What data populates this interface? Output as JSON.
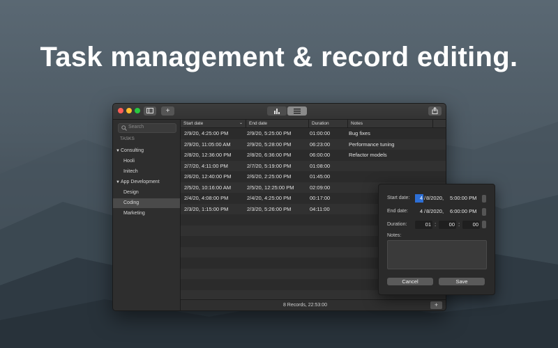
{
  "headline": "Task management & record editing.",
  "sidebar": {
    "search_placeholder": "Search",
    "section_label": "TASKS",
    "groups": [
      {
        "label": "Consulting",
        "items": [
          "Hooli",
          "Initech"
        ]
      },
      {
        "label": "App Development",
        "items": [
          "Design",
          "Coding",
          "Marketing"
        ]
      }
    ],
    "selected": "Coding"
  },
  "table": {
    "columns": [
      "Start date",
      "End date",
      "Duration",
      "Notes"
    ],
    "rows": [
      [
        "2/9/20, 4:25:00 PM",
        "2/9/20, 5:25:00 PM",
        "01:00:00",
        "Bug fixes"
      ],
      [
        "2/9/20, 11:05:00 AM",
        "2/9/20, 5:28:00 PM",
        "06:23:00",
        "Performance tuning"
      ],
      [
        "2/8/20, 12:36:00 PM",
        "2/8/20, 6:36:00 PM",
        "06:00:00",
        "Refactor models"
      ],
      [
        "2/7/20, 4:11:00 PM",
        "2/7/20, 5:19:00 PM",
        "01:08:00",
        ""
      ],
      [
        "2/6/20, 12:40:00 PM",
        "2/6/20, 2:25:00 PM",
        "01:45:00",
        ""
      ],
      [
        "2/5/20, 10:16:00 AM",
        "2/5/20, 12:25:00 PM",
        "02:09:00",
        ""
      ],
      [
        "2/4/20, 4:08:00 PM",
        "2/4/20, 4:25:00 PM",
        "00:17:00",
        ""
      ],
      [
        "2/3/20, 1:15:00 PM",
        "2/3/20, 5:26:00 PM",
        "04:11:00",
        ""
      ]
    ]
  },
  "footer": {
    "summary": "8 Records, 22:53:00"
  },
  "popover": {
    "start_label": "Start date:",
    "start_month": "4",
    "start_date": "8/2020,",
    "start_time": "5:00:00 PM",
    "end_label": "End date:",
    "end_month": "4",
    "end_date": "8/2020,",
    "end_time": "6:00:00 PM",
    "duration_label": "Duration:",
    "duration_h": "01",
    "duration_m": "00",
    "duration_s": "00",
    "notes_label": "Notes:",
    "cancel_label": "Cancel",
    "save_label": "Save"
  },
  "icons": {
    "sidebar_toggle": "sidebar-icon",
    "add": "plus-icon",
    "chart_view": "bar-chart-icon",
    "list_view": "list-icon",
    "share": "share-icon",
    "search": "search-icon"
  },
  "colors": {
    "close": "#ff5f57",
    "minimize": "#febc2e",
    "zoom": "#28c840",
    "selection": "#2d6fd6"
  }
}
